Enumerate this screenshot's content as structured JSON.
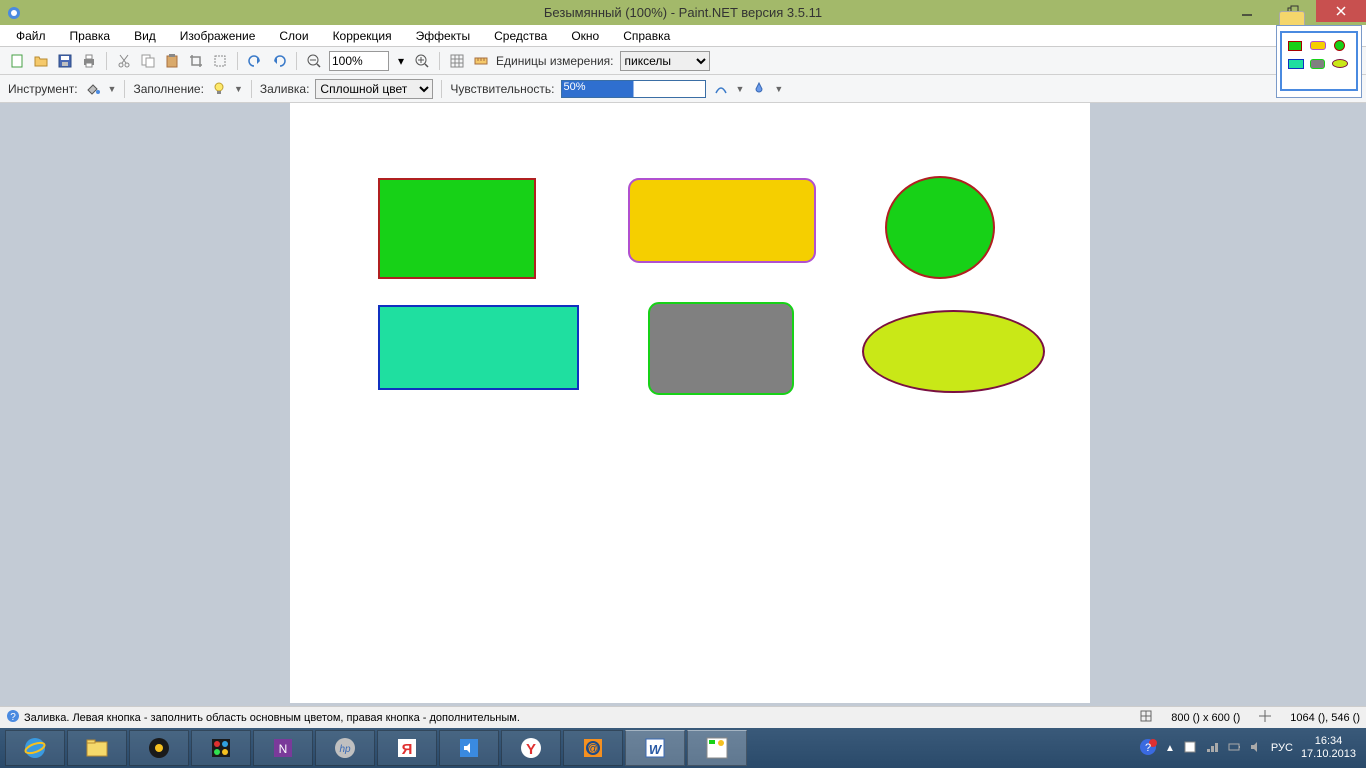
{
  "titlebar": {
    "title": "Безымянный (100%) - Paint.NET версия 3.5.11"
  },
  "menus": {
    "file": "Файл",
    "edit": "Правка",
    "view": "Вид",
    "image": "Изображение",
    "layers": "Слои",
    "adjustments": "Коррекция",
    "effects": "Эффекты",
    "tools": "Средства",
    "window": "Окно",
    "help": "Справка"
  },
  "toolbar": {
    "zoom_value": "100%",
    "units_label": "Единицы измерения:",
    "units_value": "пикселы"
  },
  "tool_options": {
    "tool_label": "Инструмент:",
    "sampling_label": "Заполнение:",
    "fill_label": "Заливка:",
    "fill_value": "Сплошной цвет",
    "tolerance_label": "Чувствительность:",
    "tolerance_value": "50%"
  },
  "status": {
    "hint": "Заливка. Левая кнопка - заполнить область основным цветом, правая кнопка - дополнительным.",
    "dims": "800 () x 600 ()",
    "cursor": "1064 (), 546 ()"
  },
  "tray": {
    "lang": "РУС",
    "time": "16:34",
    "date": "17.10.2013"
  }
}
